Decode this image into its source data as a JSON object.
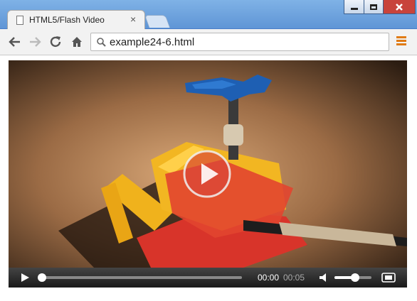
{
  "browser": {
    "tab_title": "HTML5/Flash Video",
    "tab_close": "×",
    "url": "example24-6.html"
  },
  "video": {
    "current_time": "00:00",
    "duration": "00:05",
    "progress": 0.0,
    "volume": 0.55
  },
  "colors": {
    "frame": "#5f95d6",
    "close_button": "#c8433b",
    "menu_accent": "#e07b15",
    "play_overlay": "#d9453a"
  },
  "icons": [
    "document-icon",
    "back-arrow-icon",
    "forward-arrow-icon",
    "reload-icon",
    "home-icon",
    "search-icon",
    "menu-icon",
    "play-icon",
    "volume-icon",
    "fullscreen-icon"
  ]
}
